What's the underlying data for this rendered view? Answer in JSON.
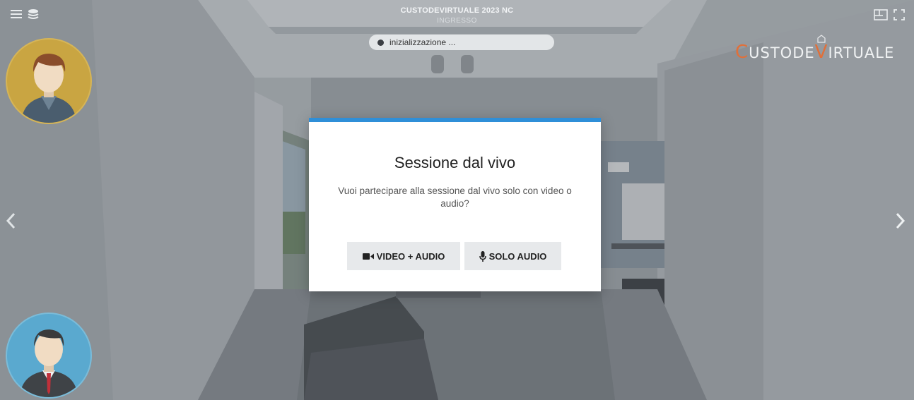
{
  "header": {
    "title": "CUSTODEVIRTUALE 2023 NC",
    "subtitle": "INGRESSO"
  },
  "status": {
    "text": "inizializzazione ..."
  },
  "brand": {
    "logo_text": "CUSTODEVIRTUALE",
    "accent_color": "#e0703a"
  },
  "toolbar": {
    "left_icons": [
      "menu-icon",
      "layers-icon"
    ],
    "right_icons": [
      "floorplan-icon",
      "fullscreen-icon"
    ]
  },
  "navigation": {
    "prev_icon": "chevron-left-icon",
    "next_icon": "chevron-right-icon"
  },
  "participants": [
    {
      "role": "guest-avatar",
      "color": "#c9a542"
    },
    {
      "role": "agent-avatar",
      "color": "#5aa9cf"
    }
  ],
  "dialog": {
    "title": "Sessione dal vivo",
    "message": "Vuoi partecipare alla sessione dal vivo solo con video o audio?",
    "accent_color": "#2f8fd8",
    "buttons": {
      "video_audio": "VIDEO + AUDIO",
      "audio_only": "SOLO AUDIO"
    }
  }
}
